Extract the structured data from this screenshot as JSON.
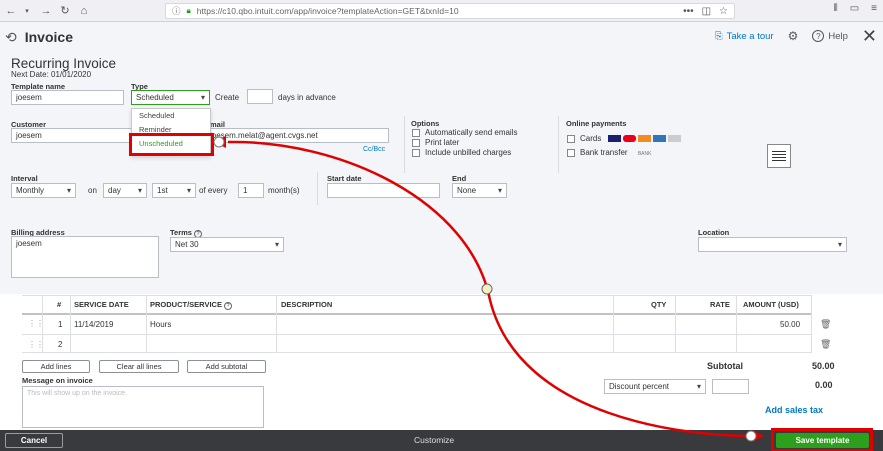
{
  "browser": {
    "url": "https://c10.qbo.intuit.com/app/invoice?templateAction=GET&txnId=10"
  },
  "header": {
    "title": "Invoice",
    "take_tour": "Take a tour",
    "help": "Help"
  },
  "template": {
    "heading": "Recurring Invoice",
    "next_date": "Next Date: 01/01/2020",
    "name_label": "Template name",
    "name_value": "joesem",
    "type_label": "Type",
    "type_value": "Scheduled",
    "create_label": "Create",
    "days_advance": "days in advance",
    "type_options": [
      "Scheduled",
      "Reminder",
      "Unscheduled"
    ]
  },
  "customer": {
    "label": "Customer",
    "value": "joesem",
    "email_label": "Email",
    "email_value": "joesem.melat@agent.cvgs.net",
    "cc_bcc": "Cc/Bcc"
  },
  "options": {
    "label": "Options",
    "items": [
      "Automatically send emails",
      "Print later",
      "Include unbilled charges"
    ]
  },
  "online_payments": {
    "label": "Online payments",
    "cards": "Cards",
    "bank": "Bank transfer",
    "bank_badge": "BANK"
  },
  "interval": {
    "label": "Interval",
    "freq": "Monthly",
    "on": "on",
    "unit": "day",
    "nth": "1st",
    "of_every": "of every",
    "count": "1",
    "months": "month(s)",
    "start_label": "Start date",
    "end_label": "End",
    "end_value": "None"
  },
  "billing": {
    "label": "Billing address",
    "value": "joesem",
    "terms_label": "Terms",
    "terms_value": "Net 30",
    "location_label": "Location"
  },
  "table": {
    "headers": [
      "#",
      "SERVICE DATE",
      "PRODUCT/SERVICE",
      "DESCRIPTION",
      "QTY",
      "RATE",
      "AMOUNT (USD)"
    ],
    "rows": [
      {
        "num": "1",
        "date": "11/14/2019",
        "product": "Hours",
        "amount": "50.00"
      },
      {
        "num": "2",
        "date": "",
        "product": "",
        "amount": ""
      }
    ],
    "add_lines": "Add lines",
    "clear_lines": "Clear all lines",
    "add_subtotal": "Add subtotal"
  },
  "totals": {
    "subtotal_label": "Subtotal",
    "subtotal_value": "50.00",
    "discount_label": "Discount percent",
    "discount_value": "0.00",
    "add_tax": "Add sales tax"
  },
  "message": {
    "label": "Message on invoice",
    "placeholder": "This will show up on the invoice."
  },
  "footer": {
    "cancel": "Cancel",
    "customize": "Customize",
    "save": "Save template"
  },
  "colors": {
    "accent_green": "#2ca01c",
    "annotation_red": "#e00000",
    "link_blue": "#0077c5"
  }
}
